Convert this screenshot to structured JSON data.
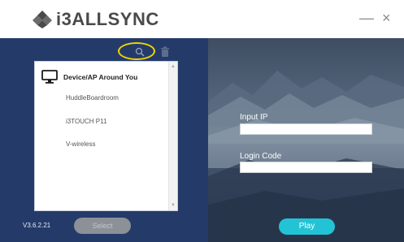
{
  "titlebar": {
    "brand": "i3ALLSYNC",
    "minimize_glyph": "—",
    "close_glyph": "×"
  },
  "toolbar": {
    "search_icon": "search-icon",
    "trash_icon": "trash-icon",
    "highlight_color": "#f2d400"
  },
  "device_list": {
    "header": "Device/AP Around You",
    "items": [
      {
        "label": "HuddleBoardroom"
      },
      {
        "label": "i3TOUCH P11"
      },
      {
        "label": "V-wireless"
      }
    ]
  },
  "footer": {
    "version": "V3.6.2.21",
    "select_label": "Select",
    "play_label": "Play"
  },
  "form": {
    "ip_label": "Input IP",
    "ip_value": "",
    "code_label": "Login Code",
    "code_value": ""
  },
  "colors": {
    "left_panel": "#243b6a",
    "play_button": "#23c3d6",
    "select_button_disabled": "#8c9097"
  }
}
